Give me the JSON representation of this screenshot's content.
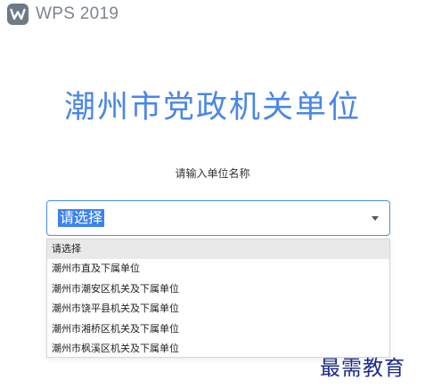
{
  "brand": {
    "icon": "wps-logo-icon",
    "name": "WPS 2019"
  },
  "page": {
    "title": "潮州市党政机关单位",
    "field_label": "请输入单位名称"
  },
  "select": {
    "value": "请选择",
    "options": [
      "请选择",
      "潮州市直及下属单位",
      "潮州市潮安区机关及下属单位",
      "潮州市饶平县机关及下属单位",
      "潮州市湘桥区机关及下属单位",
      "潮州市枫溪区机关及下属单位"
    ]
  },
  "watermark": {
    "text": "最需教育"
  },
  "colors": {
    "accent": "#4a86e8",
    "selection": "#3b82f0",
    "watermark": "#1b2a8a"
  }
}
